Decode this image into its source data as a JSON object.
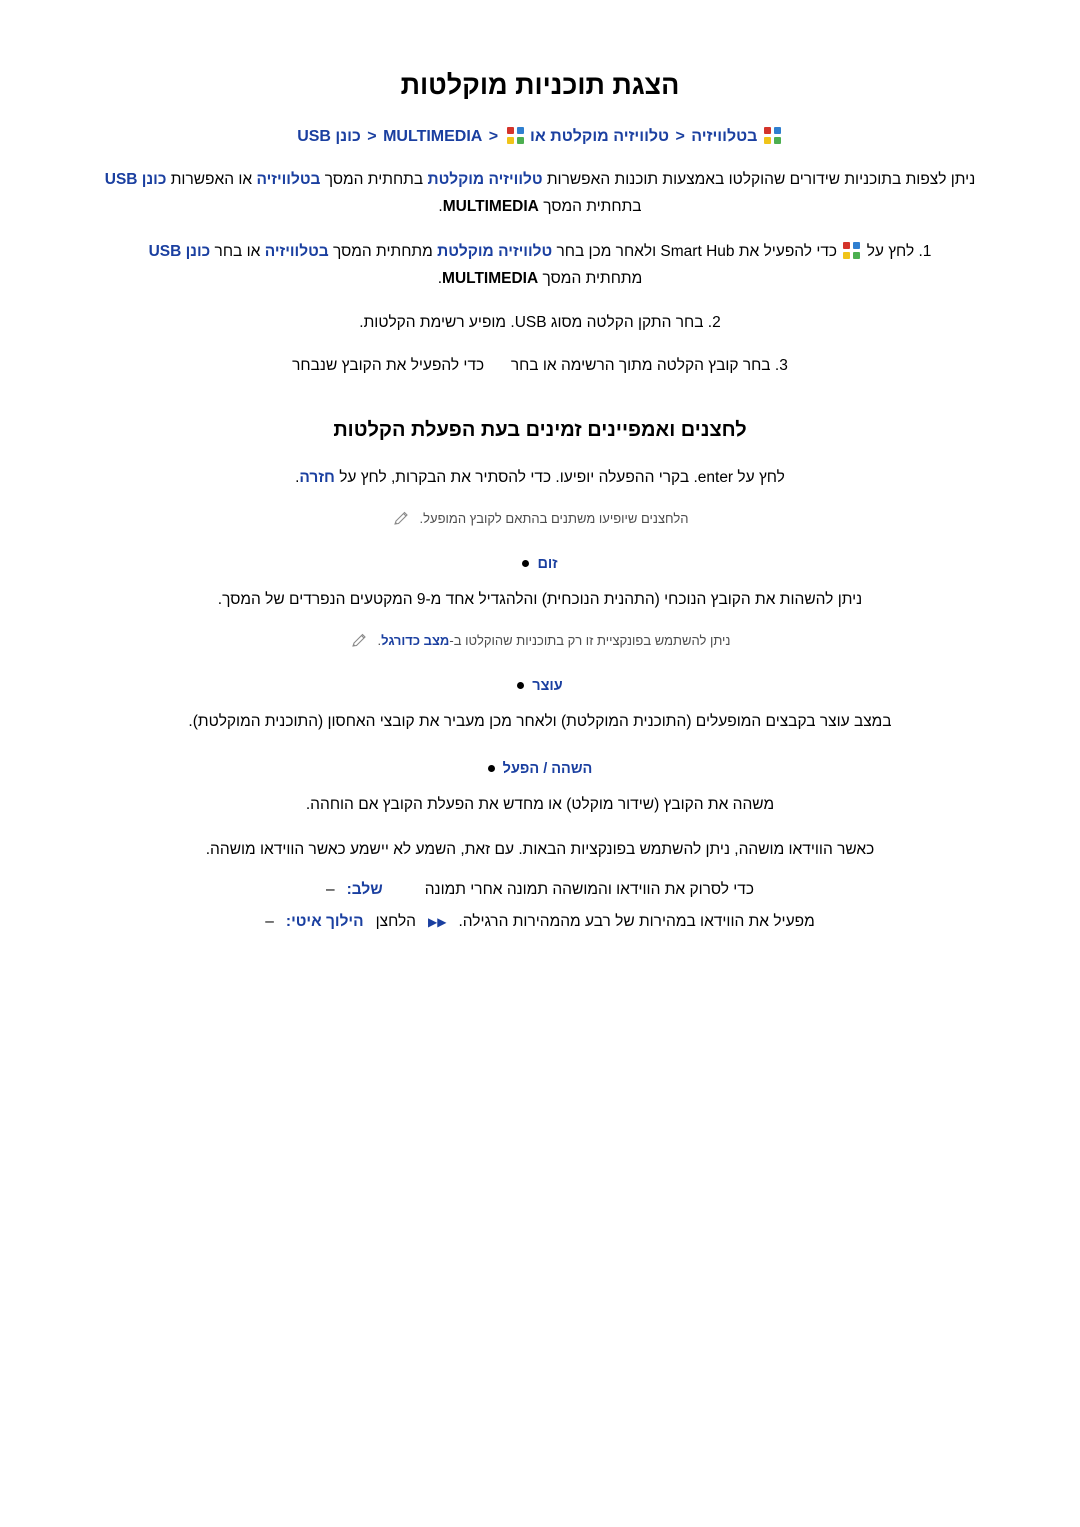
{
  "page": {
    "title": "הצגת תוכניות מוקלטות",
    "breadcrumb": {
      "item1": "בטלוויזיה",
      "sep": "<",
      "item2": "טלוויזיה מוקלטת",
      "or": "או",
      "item3": "MULTIMEDIA",
      "item4": "כונן USB"
    },
    "intro": {
      "part1": "ניתן לצפות בתוכניות שידורים שהוקלטו באמצעות תוכנות האפשרות",
      "bold1": "טלוויזיה מוקלטת",
      "part2": "בתחתית המסך",
      "bold2": "בטלוויזיה",
      "part3": "או האפשרות",
      "bold3": "כונן USB",
      "part4": "בתחתית המסך",
      "bold4": "MULTIMEDIA",
      "part5": "."
    },
    "steps": [
      {
        "num": "1.",
        "text_a": "לחץ על",
        "icon": "smart-hub-icon",
        "text_b": "כדי להפעיל את Smart Hub ולאחר מכן בחר",
        "bold_a": "טלוויזיה מוקלטת",
        "text_c": "מתחתית המסך",
        "bold_b": "בטלוויזיה",
        "text_d": "או בחר",
        "bold_c": "כונן USB",
        "text_e": "מתחתית המסך",
        "bold_d": "MULTIMEDIA",
        "text_f": "."
      },
      {
        "num": "2.",
        "text": "בחר התקן הקלטה מסוג USB. מופיע רשימת הקלטות."
      },
      {
        "num": "3.",
        "text_a": "בחר קובץ הקלטה מתוך הרשימה או בחר",
        "text_b": "כדי להפעיל את הקובץ שנבחר"
      }
    ],
    "section2": {
      "title": "לחצנים ואמפיינים זמינים בעת הפעלת הקלטות",
      "intro_a": "לחץ על enter. בקרי ההפעלה יופיעו. כדי להסתיר את הבקרות, לחץ על",
      "intro_bold": "חזרה",
      "intro_b": ".",
      "note": "הלחצנים שיופיעו משתנים בהתאם לקובץ המופעל."
    },
    "bullets": [
      {
        "label": "זום",
        "text": "ניתן להשהות את הקובץ הנוכחי (התהנית הנוכחית) והלהגדיל אחד מ-9 המקטעים הנפרדים של המסך.",
        "note_a": "ניתן להשתמש בפונקציית זו רק בתוכניות שהוקלטו ב-",
        "note_bold": "מצב כדורגל",
        "note_b": "."
      },
      {
        "label": "עוצר",
        "text": "במצב עוצר בקבצים המופעלים (התוכנית המוקלטת) ולאחר מכן מעביר את קובצי האחסון (התוכנית המוקלטת)."
      },
      {
        "label": "השהה / הפעל",
        "text_a": "משהה את הקובץ (שידור מוקלט) או מחדש את הפעלת הקובץ אם הוחהה.",
        "text_b": "כאשר הווידאו מושהה, ניתן להשתמש בפונקציות הבאות. עם זאת, השמע לא יישמע כאשר הווידאו מושהה."
      }
    ],
    "sub_items": [
      {
        "dash": "–",
        "label": "שלב:",
        "text": "כדי לסרוק את הווידאו והמושהה תמונה אחרי תמונה"
      },
      {
        "dash": "–",
        "label": "הילוך איטי:",
        "icon": "fast-forward-icon",
        "text": "הלחצן",
        "text2": "מפעיל את הווידאו במהירות של רבע מהמהירות הרגילה."
      }
    ]
  }
}
